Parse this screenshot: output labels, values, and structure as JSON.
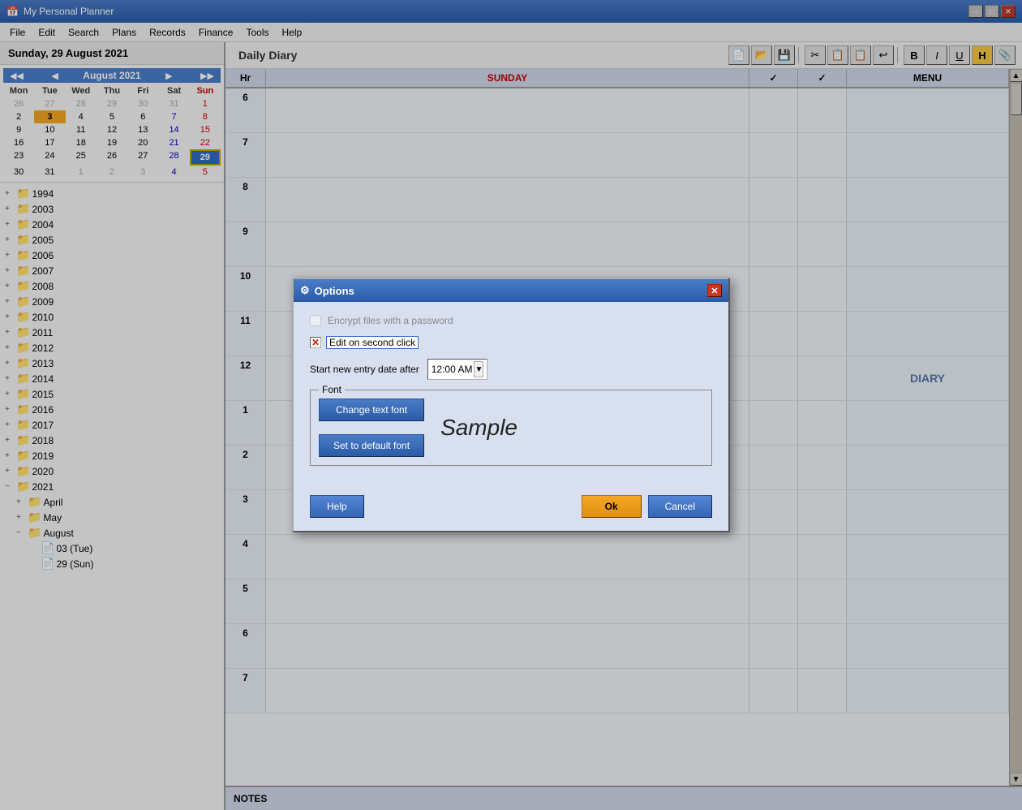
{
  "app": {
    "title": "My Personal Planner",
    "icon": "📅"
  },
  "titlebar": {
    "minimize_label": "─",
    "maximize_label": "□",
    "close_label": "✕"
  },
  "menubar": {
    "items": [
      "File",
      "Edit",
      "Search",
      "Plans",
      "Records",
      "Finance",
      "Tools",
      "Help"
    ]
  },
  "toolbar_title": "Daily Diary",
  "toolbar": {
    "buttons": [
      {
        "icon": "📄",
        "name": "new"
      },
      {
        "icon": "📂",
        "name": "open"
      },
      {
        "icon": "💾",
        "name": "save"
      },
      {
        "icon": "✂️",
        "name": "cut"
      },
      {
        "icon": "📋",
        "name": "copy"
      },
      {
        "icon": "📄",
        "name": "paste"
      },
      {
        "icon": "↩",
        "name": "undo"
      },
      {
        "icon": "B",
        "name": "bold"
      },
      {
        "icon": "I",
        "name": "italic"
      },
      {
        "icon": "U",
        "name": "underline"
      },
      {
        "icon": "H",
        "name": "highlight"
      },
      {
        "icon": "📎",
        "name": "attach"
      }
    ]
  },
  "date_header": "Sunday, 29 August 2021",
  "calendar": {
    "month_year": "August 2021",
    "day_headers": [
      "Mon",
      "Tue",
      "Wed",
      "Thu",
      "Fri",
      "Sat",
      "Sun"
    ],
    "weeks": [
      [
        "26",
        "27",
        "28",
        "29",
        "30",
        "31",
        "1"
      ],
      [
        "2",
        "3",
        "4",
        "5",
        "6",
        "7",
        "8"
      ],
      [
        "9",
        "10",
        "11",
        "12",
        "13",
        "14",
        "15"
      ],
      [
        "16",
        "17",
        "18",
        "19",
        "20",
        "21",
        "22"
      ],
      [
        "23",
        "24",
        "25",
        "26",
        "27",
        "28",
        "29"
      ],
      [
        "30",
        "31",
        "1",
        "2",
        "3",
        "4",
        "5"
      ]
    ],
    "other_month_cells": [
      "26",
      "27",
      "28",
      "29",
      "30",
      "31",
      "1",
      "26",
      "27",
      "28",
      "1",
      "2",
      "3",
      "4",
      "5"
    ]
  },
  "tree": {
    "items": [
      {
        "label": "1994",
        "level": 0,
        "expanded": false,
        "type": "year"
      },
      {
        "label": "2003",
        "level": 0,
        "expanded": false,
        "type": "year"
      },
      {
        "label": "2004",
        "level": 0,
        "expanded": false,
        "type": "year"
      },
      {
        "label": "2005",
        "level": 0,
        "expanded": false,
        "type": "year"
      },
      {
        "label": "2006",
        "level": 0,
        "expanded": false,
        "type": "year"
      },
      {
        "label": "2007",
        "level": 0,
        "expanded": false,
        "type": "year"
      },
      {
        "label": "2008",
        "level": 0,
        "expanded": false,
        "type": "year"
      },
      {
        "label": "2009",
        "level": 0,
        "expanded": false,
        "type": "year"
      },
      {
        "label": "2010",
        "level": 0,
        "expanded": false,
        "type": "year"
      },
      {
        "label": "2011",
        "level": 0,
        "expanded": false,
        "type": "year"
      },
      {
        "label": "2012",
        "level": 0,
        "expanded": false,
        "type": "year"
      },
      {
        "label": "2013",
        "level": 0,
        "expanded": false,
        "type": "year"
      },
      {
        "label": "2014",
        "level": 0,
        "expanded": false,
        "type": "year"
      },
      {
        "label": "2015",
        "level": 0,
        "expanded": false,
        "type": "year"
      },
      {
        "label": "2016",
        "level": 0,
        "expanded": false,
        "type": "year"
      },
      {
        "label": "2017",
        "level": 0,
        "expanded": false,
        "type": "year"
      },
      {
        "label": "2018",
        "level": 0,
        "expanded": false,
        "type": "year"
      },
      {
        "label": "2019",
        "level": 0,
        "expanded": false,
        "type": "year"
      },
      {
        "label": "2020",
        "level": 0,
        "expanded": false,
        "type": "year"
      },
      {
        "label": "2021",
        "level": 0,
        "expanded": true,
        "type": "year"
      },
      {
        "label": "April",
        "level": 1,
        "expanded": false,
        "type": "month"
      },
      {
        "label": "May",
        "level": 1,
        "expanded": false,
        "type": "month"
      },
      {
        "label": "August",
        "level": 1,
        "expanded": true,
        "type": "month"
      },
      {
        "label": "03 (Tue)",
        "level": 2,
        "expanded": false,
        "type": "day"
      },
      {
        "label": "29 (Sun)",
        "level": 2,
        "expanded": false,
        "type": "day"
      }
    ]
  },
  "diary": {
    "columns": [
      "Hr",
      "SUNDAY",
      "✓",
      "✓",
      "MENU"
    ],
    "hours": [
      "6",
      "7",
      "8",
      "9",
      "10",
      "11",
      "12",
      "1",
      "2",
      "3",
      "4",
      "5",
      "6",
      "7"
    ],
    "diary_label": "DIARY",
    "notes_label": "NOTES"
  },
  "dialog": {
    "title": "Options",
    "icon": "⚙",
    "encrypt_label": "Encrypt files with a password",
    "encrypt_checked": false,
    "edit_on_second_click_label": "Edit on second click",
    "edit_on_second_click_checked": true,
    "start_new_entry_label": "Start new entry date after",
    "time_value": "12:00 AM",
    "font_group_label": "Font",
    "change_font_btn": "Change text font",
    "sample_text": "Sample",
    "set_default_btn": "Set to default font",
    "help_btn": "Help",
    "ok_btn": "Ok",
    "cancel_btn": "Cancel"
  }
}
